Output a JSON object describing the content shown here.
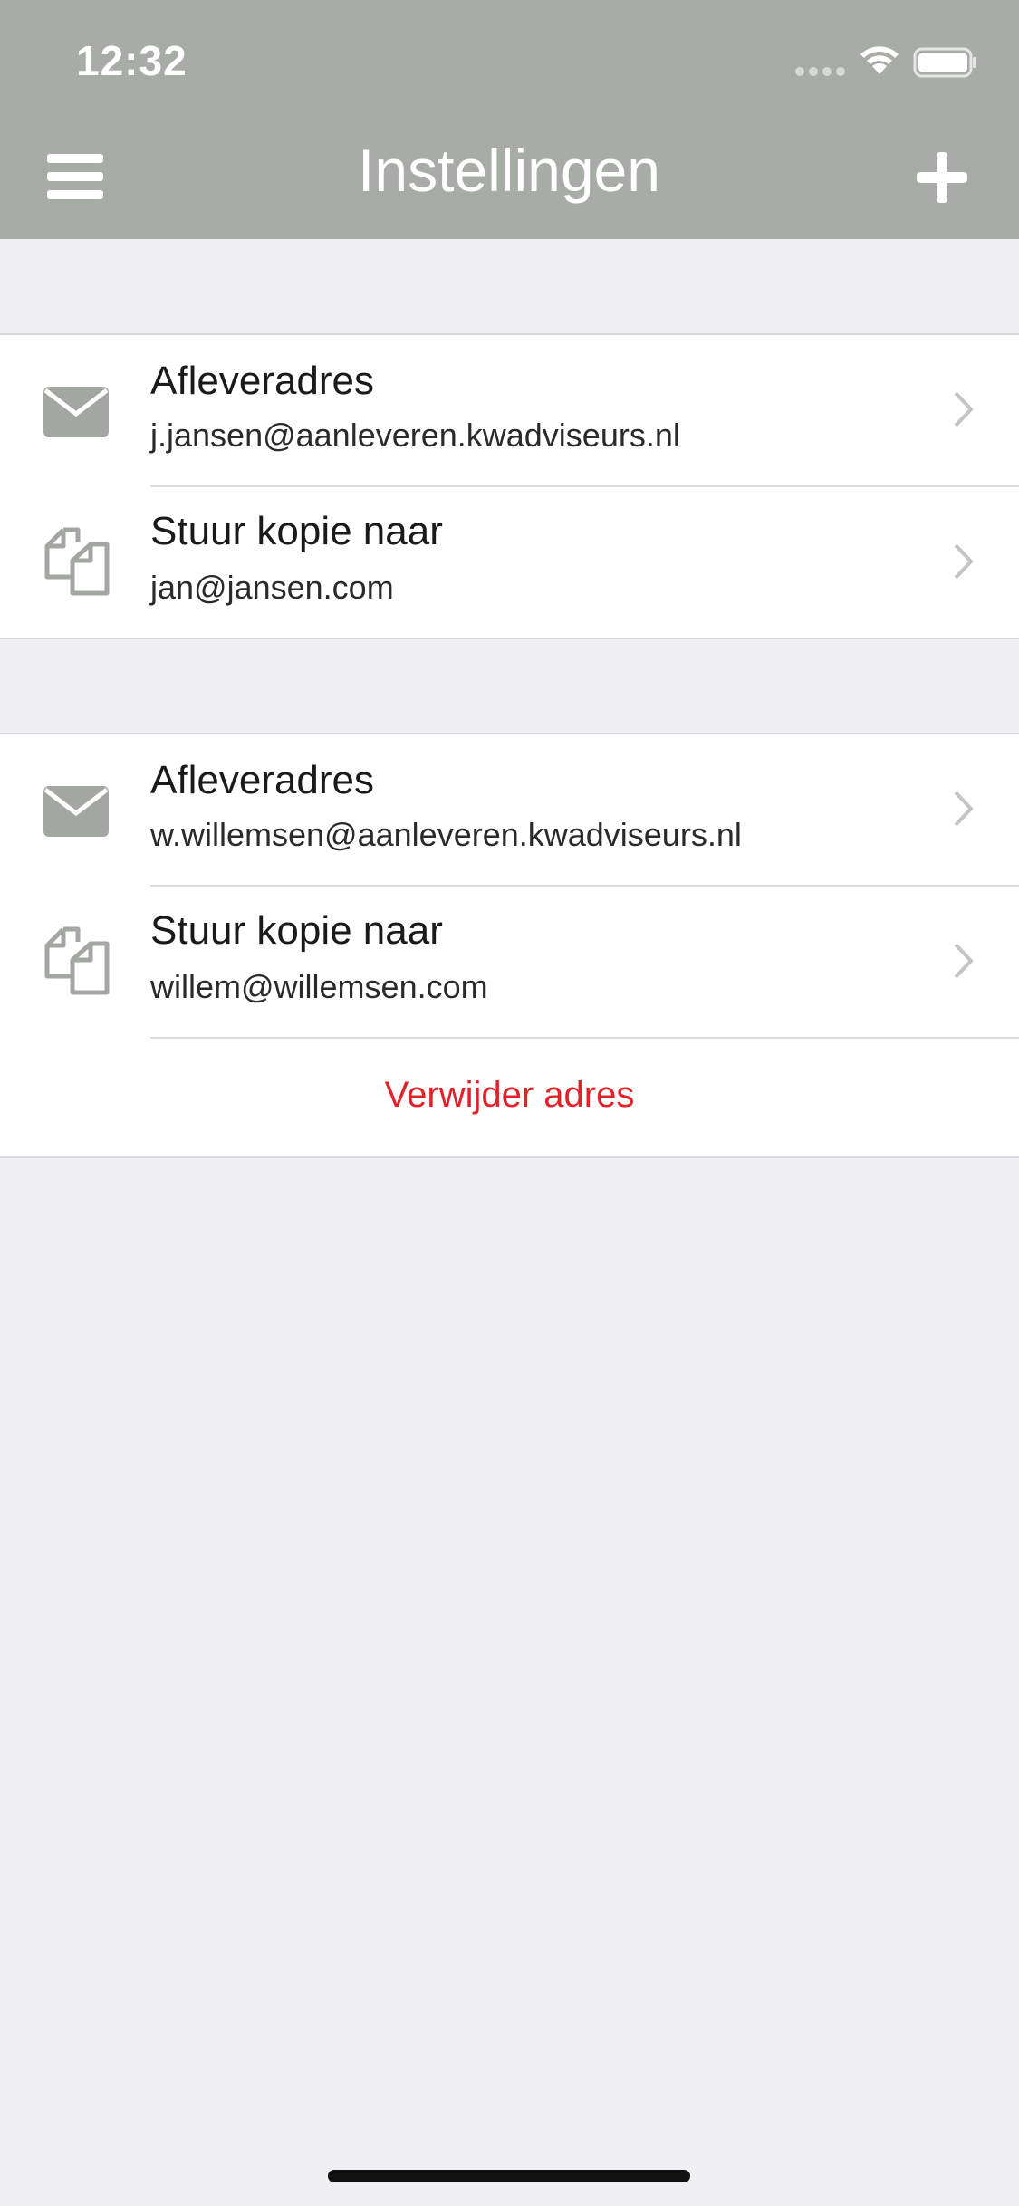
{
  "status_bar": {
    "time": "12:32"
  },
  "header": {
    "title": "Instellingen",
    "menu_icon": "hamburger-menu-icon",
    "add_icon": "plus-icon",
    "background_color": "#a8aca7"
  },
  "groups": [
    {
      "rows": [
        {
          "icon": "envelope-icon",
          "title": "Afleveradres",
          "subtitle": "j.jansen@aanleveren.kwadviseurs.nl"
        },
        {
          "icon": "copy-documents-icon",
          "title": "Stuur kopie naar",
          "subtitle": "jan@jansen.com"
        }
      ]
    },
    {
      "rows": [
        {
          "icon": "envelope-icon",
          "title": "Afleveradres",
          "subtitle": "w.willemsen@aanleveren.kwadviseurs.nl"
        },
        {
          "icon": "copy-documents-icon",
          "title": "Stuur kopie naar",
          "subtitle": "willem@willemsen.com"
        }
      ],
      "delete_label": "Verwijder adres"
    }
  ],
  "colors": {
    "accent_red": "#e0232a",
    "icon_gray": "#a3a7a2",
    "background": "#efeff4"
  }
}
